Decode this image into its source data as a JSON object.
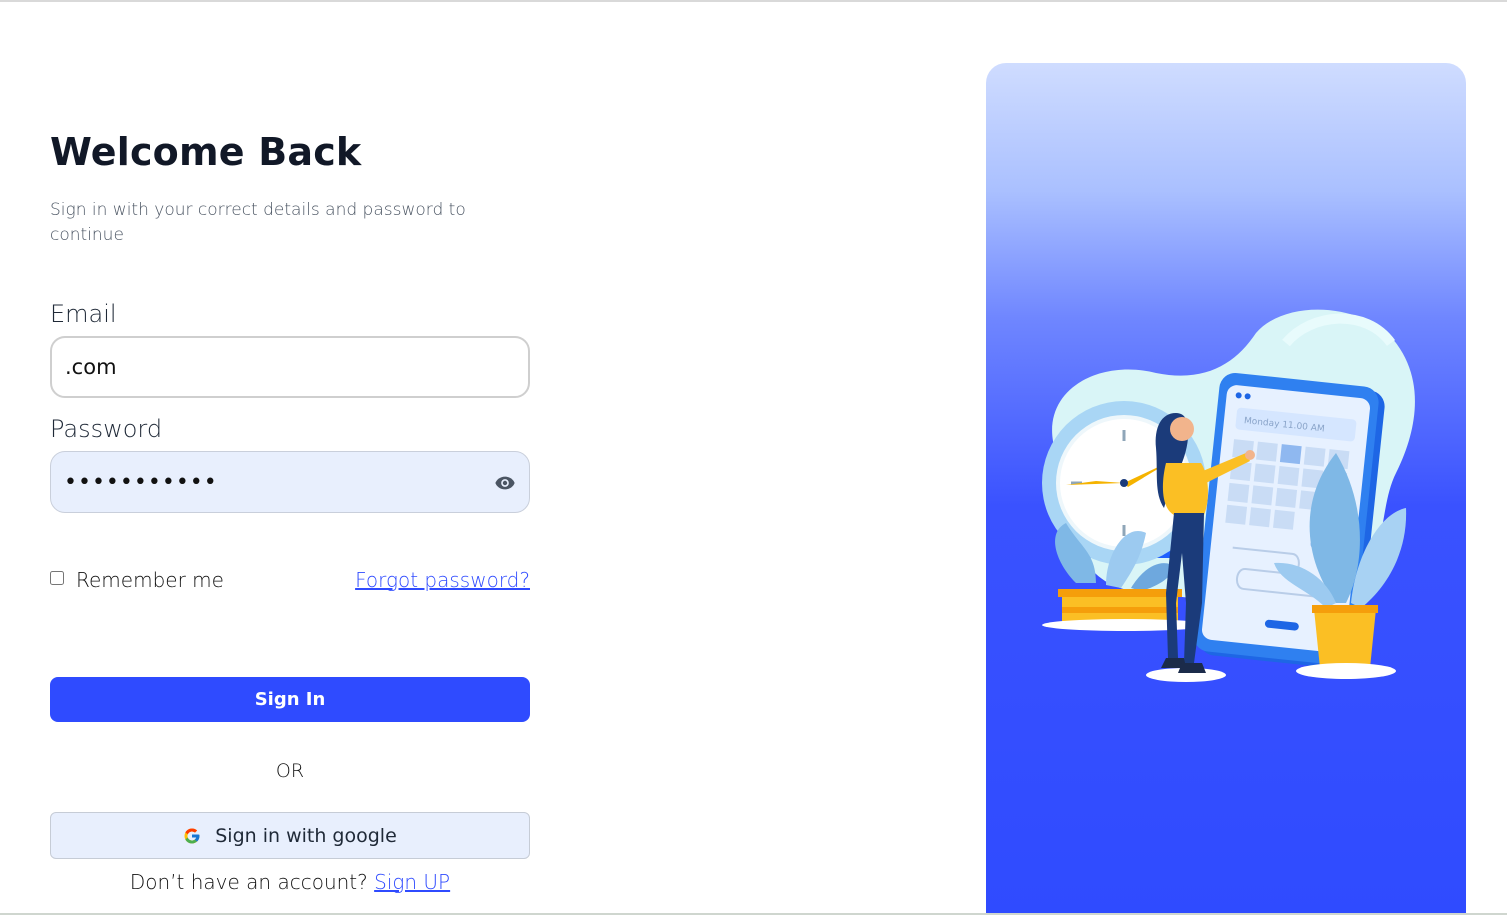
{
  "header": {
    "title": "Welcome Back",
    "subtitle": "Sign in with your correct details and password to continue"
  },
  "email": {
    "label": "Email",
    "value": ".com"
  },
  "password": {
    "label": "Password",
    "value": "•••••••••••",
    "toggle_icon": "eye-icon"
  },
  "options": {
    "remember_label": "Remember me",
    "remember_checked": false,
    "forgot_label": "Forgot password?"
  },
  "actions": {
    "signin_label": "Sign In",
    "or_label": "OR",
    "google_label": "Sign in with google",
    "google_icon": "google-icon"
  },
  "footer": {
    "prompt": "Don’t have an account?",
    "signup_label": "Sign UP"
  },
  "illustration": {
    "calendar_text": "Monday 11.00 AM",
    "icon": "calendar-illustration"
  },
  "colors": {
    "accent": "#2f4bff",
    "field_fill": "#e8effd",
    "hero_top": "#cfdcff",
    "hero_bottom": "#2f4bff"
  }
}
